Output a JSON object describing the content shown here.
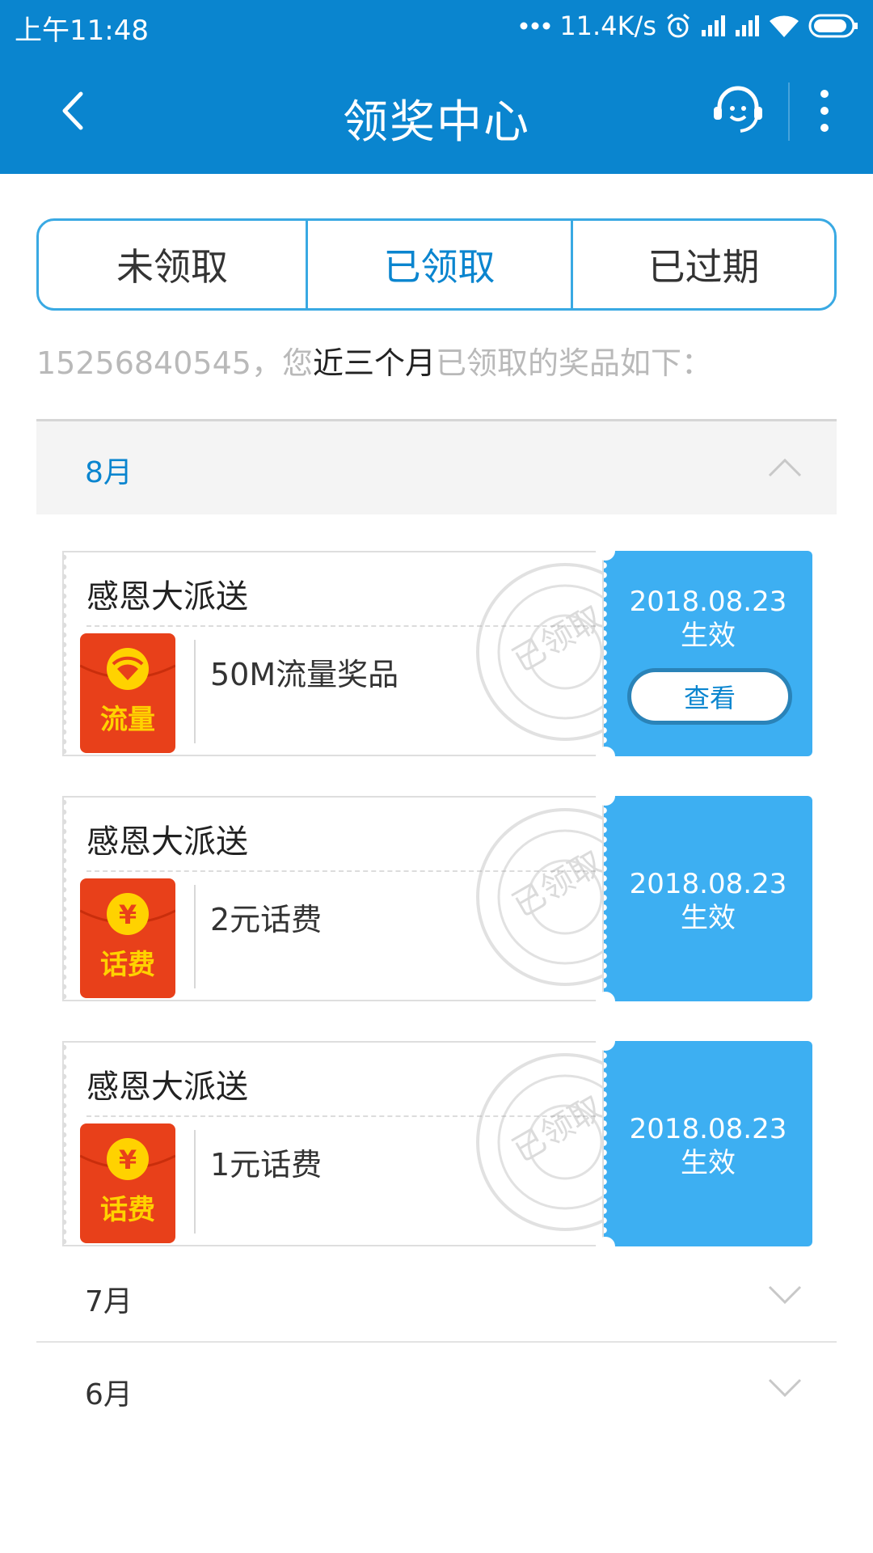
{
  "status": {
    "time": "上午11:48",
    "speed": "11.4K/s"
  },
  "nav": {
    "title": "领奖中心",
    "back_icon": "back-arrow-icon",
    "service_icon": "customer-service-icon",
    "more_icon": "more-vertical-icon"
  },
  "tabs": [
    {
      "label": "未领取",
      "active": false
    },
    {
      "label": "已领取",
      "active": true
    },
    {
      "label": "已过期",
      "active": false
    }
  ],
  "subtitle": {
    "phone": "15256840545，您",
    "highlight": "近三个月",
    "tail": "已领取的奖品如下："
  },
  "months": {
    "open": {
      "label": "8月",
      "expanded": true
    },
    "july": {
      "label": "7月",
      "expanded": false
    },
    "june": {
      "label": "6月",
      "expanded": false
    }
  },
  "cards": [
    {
      "title": "感恩大派送",
      "prize": "50M流量奖品",
      "icon_text": "流量",
      "icon_kind": "wifi",
      "date": "2018.08.23",
      "status": "生效",
      "button": "查看"
    },
    {
      "title": "感恩大派送",
      "prize": "2元话费",
      "icon_text": "话费",
      "icon_kind": "yen",
      "date": "2018.08.23",
      "status": "生效"
    },
    {
      "title": "感恩大派送",
      "prize": "1元话费",
      "icon_text": "话费",
      "icon_kind": "yen",
      "date": "2018.08.23",
      "status": "生效"
    }
  ],
  "stamp_text": "已领取",
  "colors": {
    "primary": "#0a85cf",
    "card_right": "#3daff2",
    "tab_border": "#39a9e3",
    "icon_red": "#e8401a",
    "icon_yellow": "#ffd200"
  }
}
